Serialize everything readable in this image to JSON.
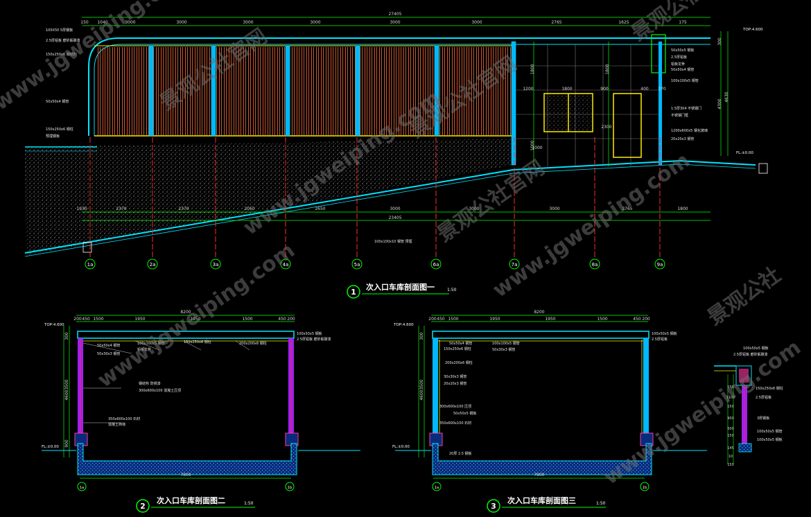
{
  "colors": {
    "frame": "#00e5ff",
    "dim": "#00ff00",
    "grid": "#ff2a2a",
    "slat": "#ff6a3a",
    "yellow": "#ffee00",
    "text": "#ffffff",
    "wall": "#ff3aa6",
    "purple": "#a020f0"
  },
  "section1": {
    "number": "1",
    "title": "次入口车库剖面图一",
    "scale": "1:50",
    "total_dim": "27405",
    "top_dims": [
      "150",
      "1040",
      "3000",
      "3000",
      "3000",
      "3000",
      "3000",
      "3000",
      "2765",
      "1625",
      "175"
    ],
    "bottom_dims": [
      "1930",
      "2370",
      "2370",
      "2050",
      "2650",
      "3000",
      "3000",
      "3000",
      "2765",
      "1800"
    ],
    "bottom_total": "23405",
    "axes": [
      "1a",
      "2a",
      "3a",
      "4a",
      "5a",
      "6a",
      "7a",
      "8a",
      "9a"
    ],
    "left_notes": [
      "100X50 5厚钢板",
      "2.5厚铝板 磨砂氟碳漆",
      "150x250x6 钢结构",
      "50x50x4 钢管",
      "150x250x6 钢柱",
      "预埋钢板"
    ],
    "right_notes": [
      "50x50x5 钢板",
      "2.5厚铝板",
      "铝板龙骨",
      "50x50x4 钢管",
      "100x100x5 钢管",
      "1.5厚304 不锈钢门",
      "不锈钢门框",
      "1200x600x5 钢化玻璃",
      "20x20x3 钢管"
    ],
    "right_dims": [
      "300",
      "4300",
      "4630",
      "1800",
      "1800",
      "1000"
    ],
    "levels": [
      "TOP:4.600",
      "FL:±0.00"
    ],
    "mid_dims": [
      "1200",
      "1800",
      "900",
      "400",
      "370",
      "2300",
      "1000"
    ],
    "ramp_note": "100x100x10 钢管 预埋"
  },
  "section2": {
    "number": "2",
    "title": "次入口车库剖面图二",
    "scale": "1:50",
    "total_dim": "8200",
    "top_dims": [
      "200",
      "450",
      "1500",
      "1950",
      "1950",
      "1500",
      "450",
      "200"
    ],
    "bottom_dim": "7800",
    "axes": [
      "1a",
      "1b"
    ],
    "levels": [
      "TOP:4.600",
      "FL:±0.00"
    ],
    "left_dims": [
      "300",
      "3500",
      "4600",
      "900"
    ],
    "notes": [
      "100x50x5 钢板",
      "2.5厚铝板 磨砂氟碳漆",
      "50x50x4 钢管",
      "100x100x5 钢管",
      "铝板龙骨",
      "150x250x6 钢柱",
      "50x30x3 钢管",
      "200x200x6 钢柱",
      "钢结构 防锈漆",
      "300x600x100 混凝土压顶",
      "350x600x100 石材",
      "混凝土挡墙"
    ]
  },
  "section3": {
    "number": "3",
    "title": "次入口车库剖面图三",
    "scale": "1:50",
    "total_dim": "8200",
    "top_dims": [
      "200",
      "450",
      "1500",
      "1950",
      "1950",
      "1500",
      "450",
      "200"
    ],
    "bottom_dim": "7800",
    "axes": [
      "1a",
      "1b"
    ],
    "levels": [
      "TOP:4.600",
      "FL:±0.00"
    ],
    "left_dims": [
      "300",
      "3500",
      "4600"
    ],
    "notes": [
      "100x50x5 钢板",
      "2.5厚铝板",
      "50x50x4 钢管",
      "150x250x6 钢柱",
      "100x100x5 钢管",
      "50x30x3 钢管",
      "200x200x6 钢柱",
      "30x30x3 钢管",
      "20x20x3 钢管",
      "300x600x100 压顶",
      "50x50x5 钢板",
      "350x600x100 石材",
      "20厚 2.5 钢板"
    ]
  },
  "detail": {
    "dims": [
      "150",
      "1100",
      "150",
      "900",
      "500",
      "150",
      "145",
      "10",
      "150"
    ],
    "notes": [
      "100x50x5 钢板",
      "2.5厚铝板 磨砂氟碳漆",
      "150x250x6 钢柱",
      "2.5厚铝板",
      "3厚钢板",
      "100x50x5 钢管",
      "100x50x5 钢板"
    ]
  },
  "watermarks": [
    "景观公社官网",
    "www.jgweiping.com",
    "景观公社官网",
    "www.jgweiping.com",
    "景观公社官网",
    "www.jgweiping.com",
    "景观公社官网",
    "www.jgweiping.com",
    "景观公社",
    "www.jgweiping.com"
  ]
}
